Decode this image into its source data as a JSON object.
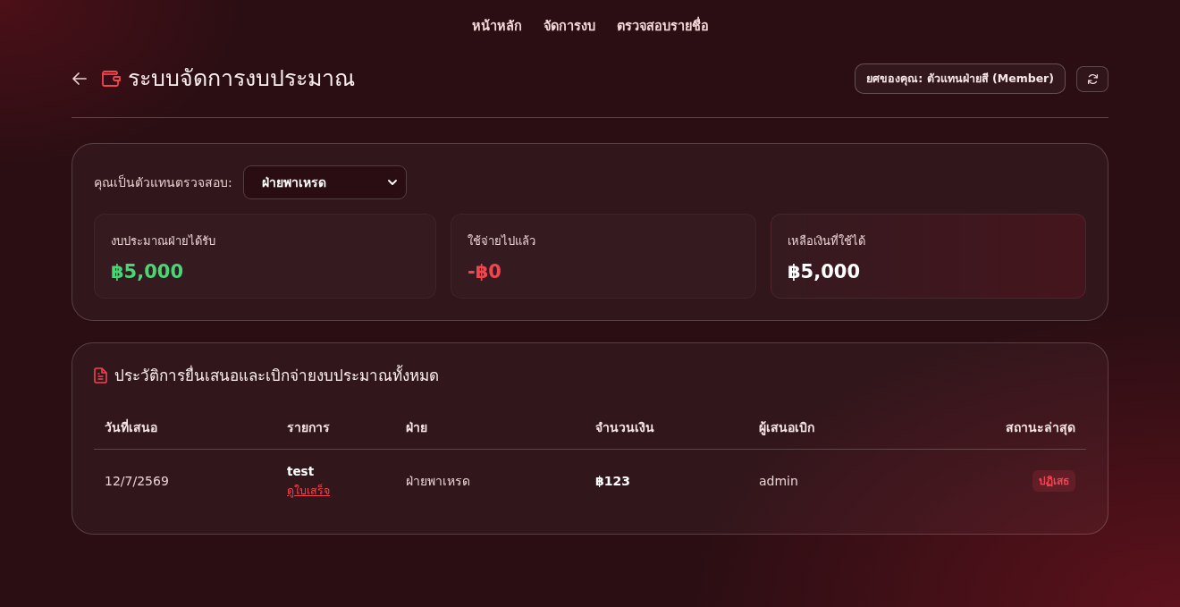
{
  "nav": [
    {
      "label": "หน้าหลัก"
    },
    {
      "label": "จัดการงบ"
    },
    {
      "label": "ตรวจสอบรายชื่อ"
    }
  ],
  "header": {
    "title": "ระบบจัดการงบประมาณ",
    "role_badge": "ยศของคุณ: ตัวแทนฝ่ายสี (Member)"
  },
  "representative": {
    "label": "คุณเป็นตัวแทนตรวจสอบ:",
    "value": "ฝ่ายพาเหรด"
  },
  "stats": [
    {
      "label": "งบประมาณฝ่ายได้รับ",
      "value": "฿5,000",
      "kind": "income"
    },
    {
      "label": "ใช้จ่ายไปแล้ว",
      "value": "-฿0",
      "kind": "expense"
    },
    {
      "label": "เหลือเงินที่ใช้ได้",
      "value": "฿5,000",
      "kind": "balance"
    }
  ],
  "history": {
    "title": "ประวัติการยื่นเสนอและเบิกจ่ายงบประมาณทั้งหมด",
    "columns": [
      "วันที่เสนอ",
      "รายการ",
      "ฝ่าย",
      "จำนวนเงิน",
      "ผู้เสนอเบิก",
      "สถานะล่าสุด"
    ],
    "rows": [
      {
        "date": "12/7/2569",
        "item": "test",
        "receipt_link": "ดูใบเสร็จ",
        "department": "ฝ่ายพาเหรด",
        "amount": "฿123",
        "requester": "admin",
        "status": {
          "label": "ปฏิเสธ",
          "kind": "rejected"
        }
      }
    ]
  }
}
